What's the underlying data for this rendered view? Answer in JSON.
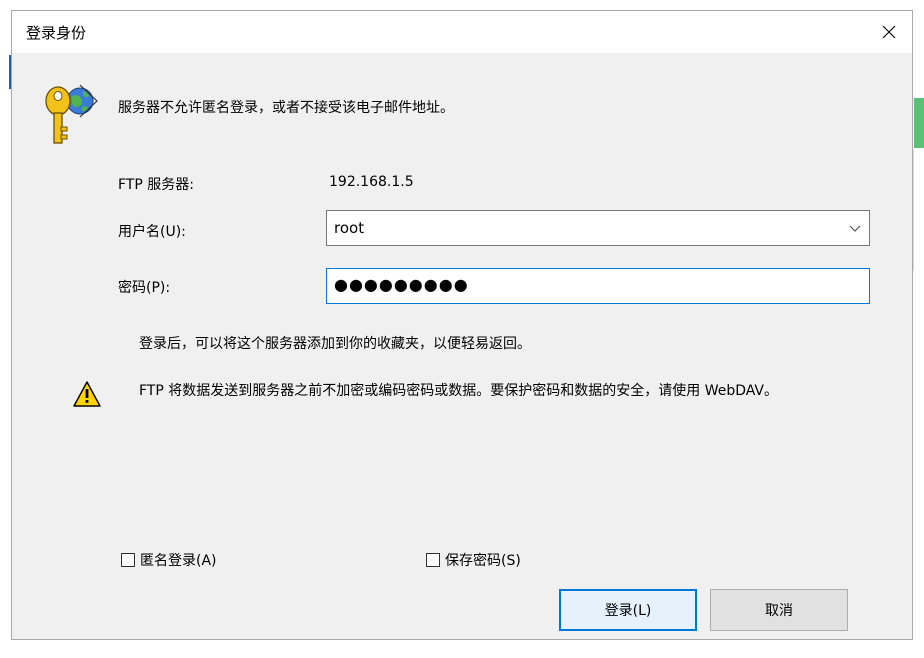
{
  "window": {
    "title": "登录身份"
  },
  "message": "服务器不允许匿名登录，或者不接受该电子邮件地址。",
  "form": {
    "server_label": "FTP 服务器:",
    "server_value": "192.168.1.5",
    "username_label": "用户名(U):",
    "username_value": "root",
    "password_label": "密码(P):",
    "password_value": "●●●●●●●●●"
  },
  "note": "登录后，可以将这个服务器添加到你的收藏夹，以便轻易返回。",
  "warning": "FTP 将数据发送到服务器之前不加密或编码密码或数据。要保护密码和数据的安全，请使用 WebDAV。",
  "checkboxes": {
    "anonymous_label": "匿名登录(A)",
    "anonymous_checked": false,
    "save_password_label": "保存密码(S)",
    "save_password_checked": false
  },
  "buttons": {
    "login_label": "登录(L)",
    "cancel_label": "取消"
  },
  "icons": {
    "close": "close-icon",
    "key": "key-icon",
    "warning": "warning-icon",
    "dropdown": "chevron-down-icon"
  },
  "colors": {
    "dialog_bg": "#f0f0f0",
    "focus_border": "#0078d7",
    "default_button_bg": "#e5f1fb",
    "button_bg": "#e1e1e1"
  }
}
